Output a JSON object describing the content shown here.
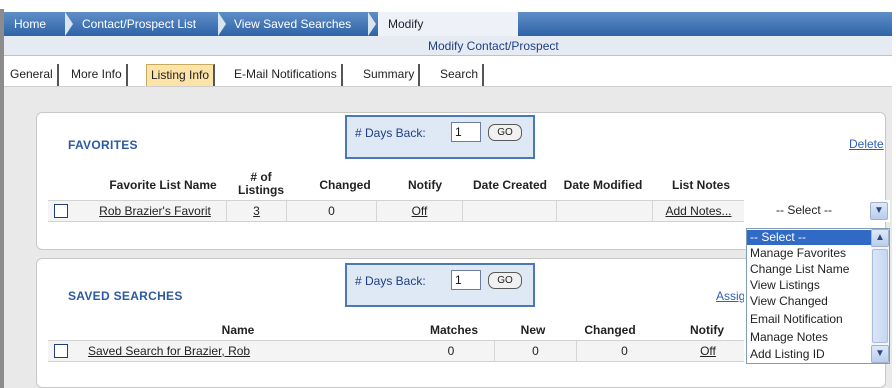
{
  "breadcrumbs": {
    "items": [
      "Home",
      "Contact/Prospect List",
      "View Saved Searches"
    ],
    "active": "Modify Contact/Prospect"
  },
  "subheader": {
    "title": "Modify Contact/Prospect"
  },
  "tabs": [
    {
      "label": "General",
      "active": false
    },
    {
      "label": "More Info",
      "active": false
    },
    {
      "label": "Listing Info",
      "active": true
    },
    {
      "label": "E-Mail Notifications",
      "active": false
    },
    {
      "label": "Summary",
      "active": false
    },
    {
      "label": "Search",
      "active": false
    }
  ],
  "favorites": {
    "title": "FAVORITES",
    "days_back_label": "# Days Back:",
    "days_back_value": "1",
    "go_label": "GO",
    "delete_label": "Delete",
    "columns": {
      "name": "Favorite List Name",
      "listings_line1": "# of",
      "listings_line2": "Listings",
      "changed": "Changed",
      "notify": "Notify",
      "date_created": "Date Created",
      "date_modified": "Date Modified",
      "list_notes": "List Notes"
    },
    "rows": [
      {
        "name": "Rob Brazier's Favorit",
        "listings": "3",
        "changed": "0",
        "notify": "Off",
        "date_created": "",
        "date_modified": "",
        "list_notes": "Add Notes...",
        "action_select": "-- Select --"
      }
    ],
    "action_options": [
      "-- Select --",
      "Manage Favorites",
      "Change List Name",
      "View Listings",
      "View Changed",
      "Email Notification",
      "Manage Notes",
      "Add Listing ID"
    ]
  },
  "saved_searches": {
    "title": "SAVED SEARCHES",
    "days_back_label": "# Days Back:",
    "days_back_value": "1",
    "go_label": "GO",
    "assign_label": "Assig",
    "columns": {
      "name": "Name",
      "matches": "Matches",
      "new": "New",
      "changed": "Changed",
      "notify": "Notify"
    },
    "rows": [
      {
        "name": "Saved Search for Brazier, Rob",
        "matches": "0",
        "new": "0",
        "changed": "0",
        "notify": "Off"
      }
    ]
  },
  "icons": {
    "dropdown_arrow": "chevron-down-icon",
    "scroll_up": "chevron-up-icon",
    "scroll_down": "chevron-down-icon"
  }
}
